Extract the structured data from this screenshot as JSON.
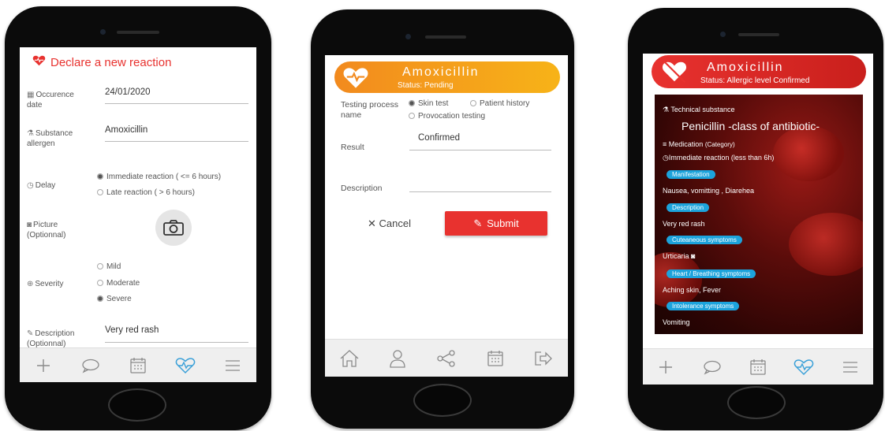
{
  "colors": {
    "accent_red": "#e8322f",
    "pill_orange": "#f59a1c",
    "chip_blue": "#1ca3dc",
    "tab_icon": "#8a8a8a",
    "tab_active": "#3aa0d8"
  },
  "declare": {
    "title": "Declare a new reaction",
    "occurrence_label": "Occurence date",
    "occurrence_value": "24/01/2020",
    "substance_label": "Substance allergen",
    "substance_value": "Amoxicillin",
    "delay_label": "Delay",
    "delay_options": [
      "Immediate reaction ( <= 6 hours)",
      "Late reaction ( > 6 hours)"
    ],
    "delay_selected": 0,
    "picture_label": "Picture (Optionnal)",
    "severity_label": "Severity",
    "severity_options": [
      "Mild",
      "Moderate",
      "Severe"
    ],
    "severity_selected": 2,
    "description_label": "Description (Optionnal)",
    "description_value": "Very red rash"
  },
  "test": {
    "drug": "Amoxicillin",
    "status": "Status: Pending",
    "process_label": "Testing process name",
    "process_options": [
      "Skin test",
      "Patient history",
      "Provocation testing"
    ],
    "process_selected": 0,
    "result_label": "Result",
    "result_value": "Confirmed",
    "description_label": "Description",
    "cancel": "Cancel",
    "submit": "Submit"
  },
  "detail": {
    "drug": "Amoxicillin",
    "status": "Status: Allergic level Confirmed",
    "technical_label": "Technical substance",
    "substance_class": "Penicillin -class of antibiotic-",
    "medication": "Medication",
    "category": "(Category)",
    "reaction_timing": "Immediate reaction (less than 6h)",
    "sections": [
      {
        "chip": "Manifestation",
        "text": "Nausea, vomitting , Diarehea"
      },
      {
        "chip": "Description",
        "text": "Very red rash"
      },
      {
        "chip": "Cuteaneous symptoms",
        "text": "Urticaria"
      },
      {
        "chip": "Heart / Breathing symptoms",
        "text": "Aching skin, Fever"
      },
      {
        "chip": "Intolerance symptoms",
        "text": "Vomiting"
      }
    ]
  },
  "tabbar_icons": [
    "plus-icon",
    "chat-icon",
    "calendar-icon",
    "heartbeat-icon",
    "menu-icon"
  ],
  "tabbar2_icons": [
    "home-icon",
    "user-icon",
    "share-icon",
    "calendar-icon",
    "logout-icon"
  ]
}
